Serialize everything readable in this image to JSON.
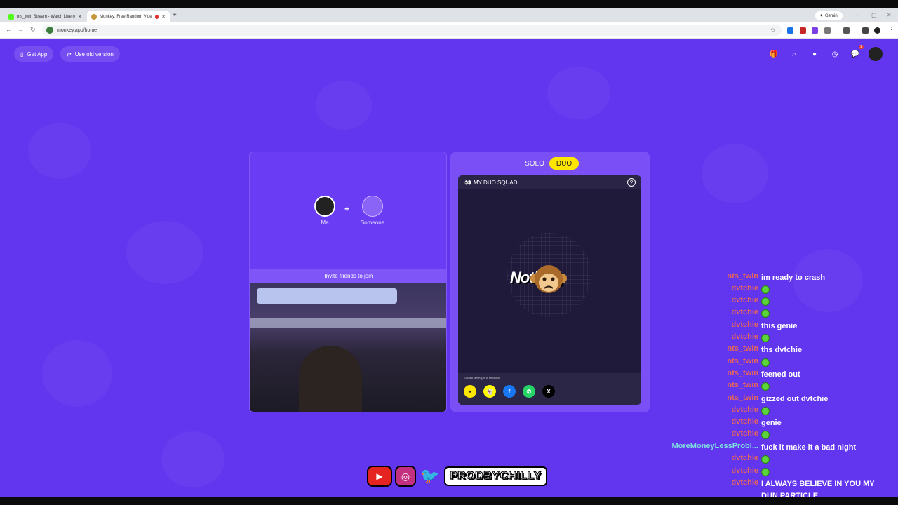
{
  "browser": {
    "tabs": [
      {
        "title": "nts_twin Stream - Watch Live o",
        "active": false
      },
      {
        "title": "Monkey: Free Random Vide",
        "active": true
      }
    ],
    "gemini_label": "Gemini",
    "url": "monkey.app/home"
  },
  "header": {
    "get_app": "Get App",
    "use_old_version": "Use old version",
    "chat_badge": "2"
  },
  "left_panel": {
    "me_label": "Me",
    "someone_label": "Someone",
    "invite_label": "Invite friends to join"
  },
  "right_panel": {
    "mode_solo": "SOLO",
    "mode_duo": "DUO",
    "squad_title": "MY DUO SQUAD",
    "nothing_text": "Nothing",
    "share_label": "Share with your friends"
  },
  "chat": {
    "lines": [
      {
        "user": "nts_twin",
        "msg": "im ready to crash",
        "color": "#e6655c"
      },
      {
        "user": "dvtchie",
        "msg": "",
        "emote": true,
        "color": "#e6655c"
      },
      {
        "user": "dvtchie",
        "msg": "",
        "emote": true,
        "color": "#e6655c"
      },
      {
        "user": "dvtchie",
        "msg": "",
        "emote": true,
        "color": "#e6655c"
      },
      {
        "user": "dvtchie",
        "msg": "this genie",
        "color": "#e6655c"
      },
      {
        "user": "dvtchie",
        "msg": "",
        "emote": true,
        "color": "#e6655c"
      },
      {
        "user": "nts_twin",
        "msg": "ths dvtchie",
        "color": "#e6655c"
      },
      {
        "user": "nts_twin",
        "msg": "",
        "emote": true,
        "color": "#e6655c"
      },
      {
        "user": "nts_twin",
        "msg": "feened out",
        "color": "#e6655c"
      },
      {
        "user": "nts_twin",
        "msg": "",
        "emote": true,
        "color": "#e6655c"
      },
      {
        "user": "nts_twin",
        "msg": "gizzed out dvtchie",
        "color": "#e6655c"
      },
      {
        "user": "dvtchie",
        "msg": "",
        "emote": true,
        "color": "#e6655c"
      },
      {
        "user": "dvtchie",
        "msg": "genie",
        "color": "#e6655c"
      },
      {
        "user": "dvtchie",
        "msg": "",
        "emote": true,
        "color": "#e6655c"
      },
      {
        "user": "MoreMoneyLessProbl...",
        "msg": "fuck it make it a bad night",
        "color": "#7fe0e0"
      },
      {
        "user": "dvtchie",
        "msg": "",
        "emote": true,
        "color": "#e6655c"
      },
      {
        "user": "dvtchie",
        "msg": "",
        "emote": true,
        "color": "#e6655c"
      },
      {
        "user": "dvtchie",
        "msg": "I ALWAYS BELIEVE IN YOU MY DUN PARTICLE",
        "color": "#e6655c"
      }
    ]
  },
  "overlay": {
    "streamer_name": "PRODBYCHILLY"
  },
  "colors": {
    "page_bg": "#6235ef",
    "duo_active": "#ffe600",
    "card_bg": "#1f1a3a"
  }
}
